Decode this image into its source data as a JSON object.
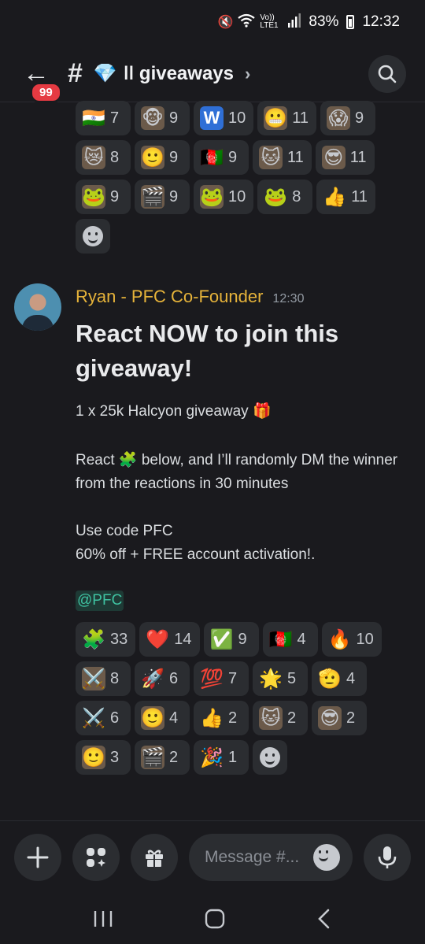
{
  "status_bar": {
    "signal_label": "Vo)) LTE1",
    "battery": "83%",
    "time": "12:32"
  },
  "header": {
    "back_badge": "99",
    "channel_emoji": "💎",
    "channel_name": "ǀǀ giveaways",
    "chevron": "›"
  },
  "top_reactions": [
    {
      "emoji": "🇮🇳",
      "count": "7"
    },
    {
      "emoji": "🐵",
      "count": "9",
      "img": true
    },
    {
      "emoji": "W",
      "count": "10",
      "w": true
    },
    {
      "emoji": "😬",
      "count": "11",
      "img": true
    },
    {
      "emoji": "😱",
      "count": "9",
      "img": true
    },
    {
      "emoji": "😿",
      "count": "8",
      "img": true
    },
    {
      "emoji": "🙂",
      "count": "9",
      "img": true
    },
    {
      "emoji": "🇦🇫",
      "count": "9"
    },
    {
      "emoji": "🐱",
      "count": "11",
      "img": true
    },
    {
      "emoji": "😎",
      "count": "11",
      "img": true
    },
    {
      "emoji": "🐸",
      "count": "9",
      "img": true
    },
    {
      "emoji": "🎬",
      "count": "9",
      "img": true
    },
    {
      "emoji": "🐸",
      "count": "10",
      "img": true
    },
    {
      "emoji": "🐸",
      "count": "8"
    },
    {
      "emoji": "👍",
      "count": "11"
    }
  ],
  "message": {
    "author": "Ryan - PFC Co-Founder",
    "timestamp": "12:30",
    "title": "React NOW to join this giveaway!",
    "line1": "1 x 25k Halcyon giveaway 🎁",
    "line2": "React 🧩 below, and I’ll randomly DM the winner from the reactions in 30 minutes",
    "line3a": "Use code PFC",
    "line3b": "60% off + FREE account activation!.",
    "mention": "@PFC"
  },
  "message_reactions": [
    {
      "emoji": "🧩",
      "count": "33"
    },
    {
      "emoji": "❤️",
      "count": "14"
    },
    {
      "emoji": "✅",
      "count": "9"
    },
    {
      "emoji": "🇦🇫",
      "count": "4"
    },
    {
      "emoji": "🔥",
      "count": "10"
    },
    {
      "emoji": "⚔️",
      "count": "8",
      "img": true
    },
    {
      "emoji": "🚀",
      "count": "6"
    },
    {
      "emoji": "💯",
      "count": "7"
    },
    {
      "emoji": "🌟",
      "count": "5"
    },
    {
      "emoji": "🫡",
      "count": "4"
    },
    {
      "emoji": "⚔️",
      "count": "6"
    },
    {
      "emoji": "🙂",
      "count": "4",
      "img": true
    },
    {
      "emoji": "👍",
      "count": "2"
    },
    {
      "emoji": "🐱",
      "count": "2",
      "img": true
    },
    {
      "emoji": "😎",
      "count": "2",
      "img": true
    },
    {
      "emoji": "🙂",
      "count": "3",
      "img": true
    },
    {
      "emoji": "🎬",
      "count": "2",
      "img": true
    },
    {
      "emoji": "🎉",
      "count": "1"
    }
  ],
  "composer": {
    "placeholder": "Message #..."
  }
}
